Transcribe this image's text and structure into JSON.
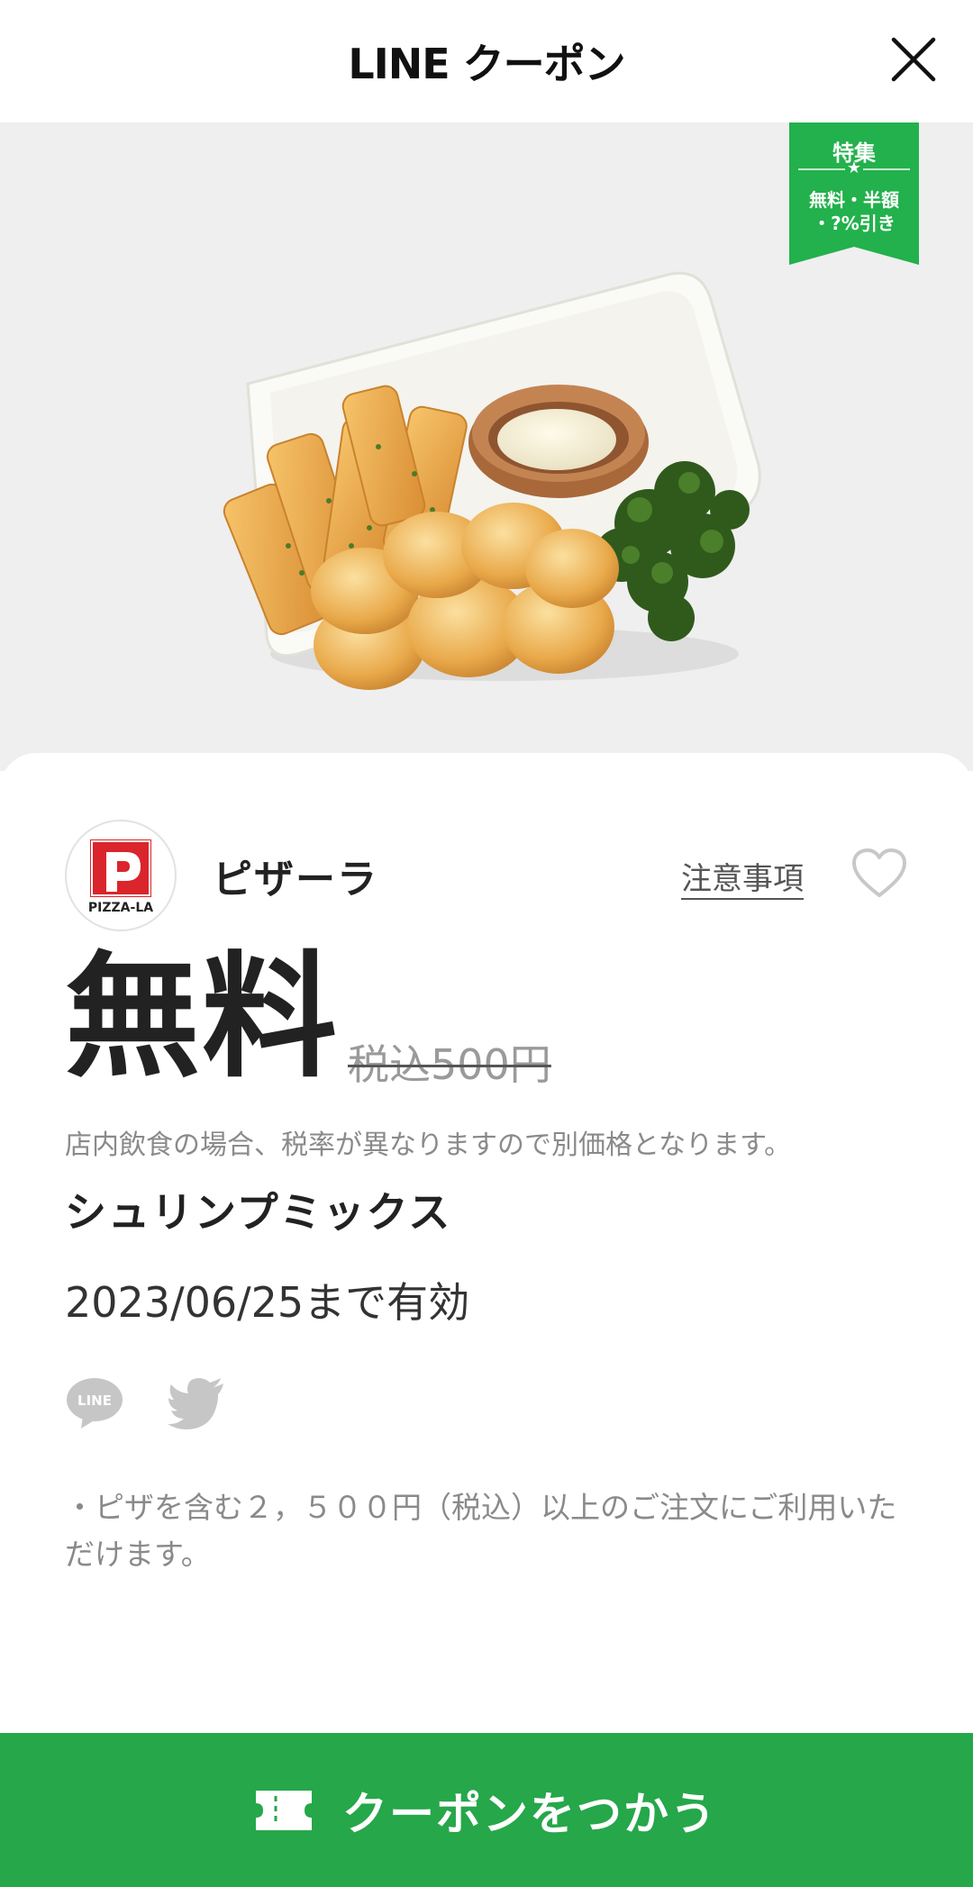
{
  "header": {
    "title": "LINE クーポン",
    "close_icon": "close-icon"
  },
  "badge": {
    "line1": "特集",
    "star": "★",
    "line2": "無料・半額",
    "line3": "・?%引き",
    "color": "#22b14c"
  },
  "store": {
    "name": "ピザーラ",
    "logo_text": "PIZZA-LA",
    "notice_label": "注意事項",
    "favorite_icon": "heart-icon"
  },
  "coupon": {
    "price": "無料",
    "original_price": "税込500円",
    "tax_note": "店内飲食の場合、税率が異なりますので別価格となります。",
    "product": "シュリンプミックス",
    "validity": "2023/06/25まで有効",
    "terms": "・ピザを含む２，５００円（税込）以上のご注文にご利用いただけます。"
  },
  "share": {
    "line_icon": "line-icon",
    "line_text": "LINE",
    "twitter_icon": "twitter-icon"
  },
  "action": {
    "use_label": "クーポンをつかう",
    "icon": "ticket-icon",
    "color": "#26a74a"
  }
}
